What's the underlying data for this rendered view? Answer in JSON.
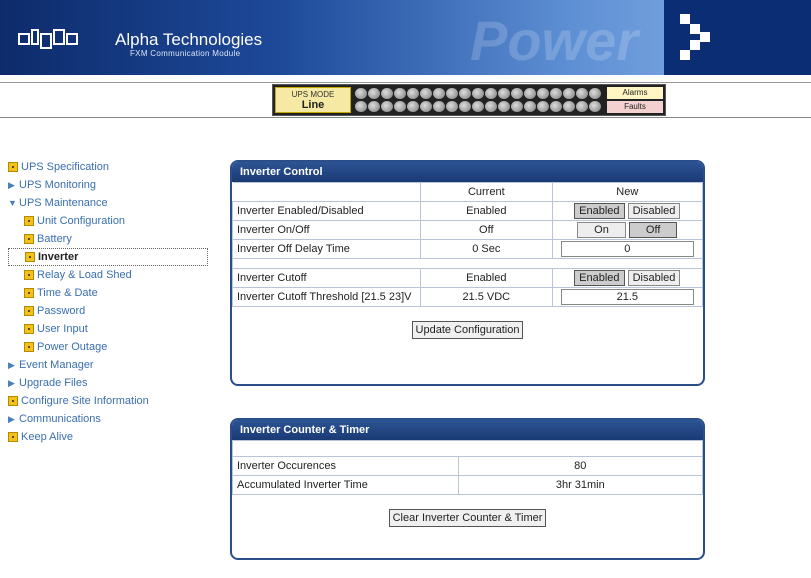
{
  "header": {
    "brand": "Alpha Technologies",
    "subtitle": "FXM Communication Module",
    "watermark": "Power"
  },
  "status_bar": {
    "mode_label": "UPS MODE",
    "mode_value": "Line",
    "alarms_label": "Alarms",
    "faults_label": "Faults"
  },
  "nav": {
    "items": [
      {
        "label": "UPS Specification"
      },
      {
        "label": "UPS Monitoring"
      },
      {
        "label": "UPS Maintenance"
      },
      {
        "label": "Unit Configuration"
      },
      {
        "label": "Battery"
      },
      {
        "label": "Inverter"
      },
      {
        "label": "Relay & Load Shed"
      },
      {
        "label": "Time & Date"
      },
      {
        "label": "Password"
      },
      {
        "label": "User Input"
      },
      {
        "label": "Power Outage"
      },
      {
        "label": "Event Manager"
      },
      {
        "label": "Upgrade Files"
      },
      {
        "label": "Configure Site Information"
      },
      {
        "label": "Communications"
      },
      {
        "label": "Keep Alive"
      }
    ]
  },
  "inverter_control": {
    "title": "Inverter Control",
    "col_current": "Current",
    "col_new": "New",
    "rows": [
      {
        "label": "Inverter Enabled/Disabled",
        "current": "Enabled",
        "opt1": "Enabled",
        "opt2": "Disabled"
      },
      {
        "label": "Inverter On/Off",
        "current": "Off",
        "opt1": "On",
        "opt2": "Off"
      },
      {
        "label": "Inverter Off Delay Time",
        "current": "0 Sec",
        "value": "0"
      },
      {
        "label": "Inverter Cutoff",
        "current": "Enabled",
        "opt1": "Enabled",
        "opt2": "Disabled"
      },
      {
        "label": "Inverter Cutoff Threshold [21.5 23]V",
        "current": "21.5 VDC",
        "value": "21.5"
      }
    ],
    "update_label": "Update Configuration"
  },
  "inverter_counter": {
    "title": "Inverter Counter & Timer",
    "rows": [
      {
        "label": "Inverter Occurences",
        "value": "80"
      },
      {
        "label": "Accumulated Inverter Time",
        "value": "3hr 31min"
      }
    ],
    "clear_label": "Clear Inverter Counter & Timer"
  }
}
